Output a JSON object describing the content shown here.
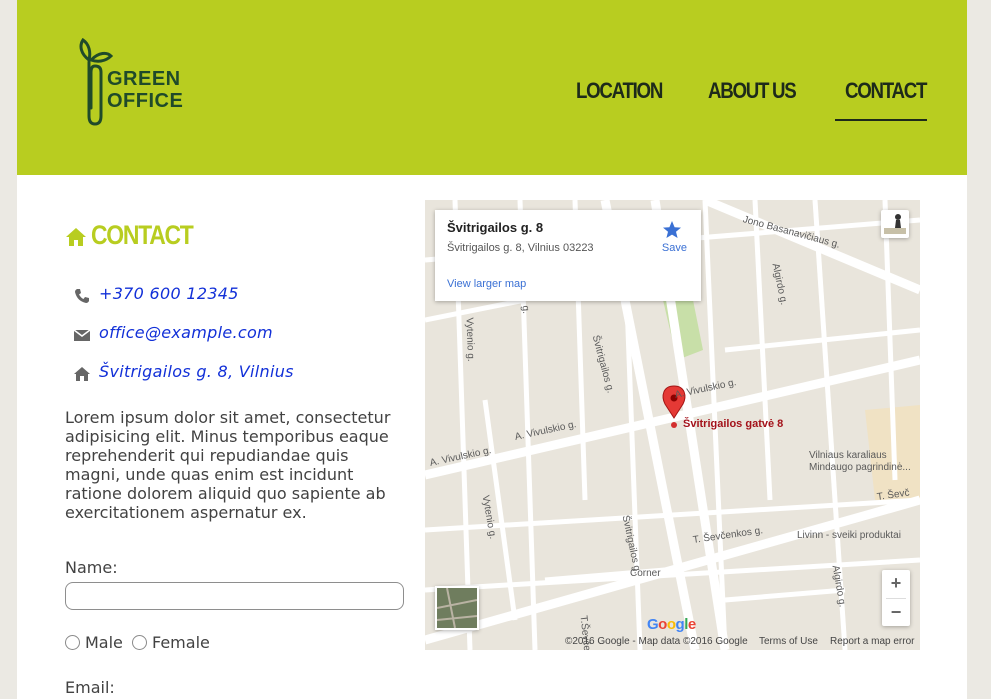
{
  "brand": {
    "line1": "GREEN",
    "line2": "OFFICE"
  },
  "nav": {
    "items": [
      {
        "label": "LOCATION"
      },
      {
        "label": "ABOUT US"
      },
      {
        "label": "CONTACT"
      }
    ],
    "active": "CONTACT"
  },
  "colors": {
    "accent": "#b8cd20",
    "link": "#1230d8",
    "brand_dark": "#1f4a2a"
  },
  "contact": {
    "heading": "CONTACT",
    "phone": "+370 600 12345",
    "email": "office@example.com",
    "address": "Švitrigailos g. 8, Vilnius",
    "description": "Lorem ipsum dolor sit amet, consectetur adipisicing elit. Minus temporibus eaque reprehenderit qui repudiandae quis magni, unde quas enim est incidunt ratione dolorem aliquid quo sapiente ab exercitationem aspernatur ex."
  },
  "form": {
    "name_label": "Name:",
    "name_value": "",
    "gender_options": [
      "Male",
      "Female"
    ],
    "email_label": "Email:"
  },
  "map": {
    "card_title": "Švitrigailos g. 8",
    "card_subtitle": "Švitrigailos g. 8, Vilnius 03223",
    "card_link": "View larger map",
    "save_label": "Save",
    "pin_label": "Švitrigailos gatvė 8",
    "zoom_in": "+",
    "zoom_out": "−",
    "streets": {
      "basanaviciaus": "Jono Basanavičiaus g.",
      "algirdo_top": "Algirdo g.",
      "vytenio_top": "Vytenio g.",
      "s_top": "g.",
      "svitrigailos_top": "Švitrigailos g.",
      "vivulskio_right": "A. Vivulskio g.",
      "vivulskio_mid": "A. Vivulskio g.",
      "vivulskio_left": "A. Vivulskio g.",
      "vytenio_bottom": "Vytenio g.",
      "svitrigailos_bottom": "Švitrigailos g.",
      "sevcenkos_mid": "T. Ševčenkos g.",
      "sevcenkos_right": "T. Ševč",
      "algirdo_bottom": "Algirdo g.",
      "tsev_vertical": "T.Ševčenko",
      "gym_label": "Vilniaus karaliaus Mindaugo pagrindinė...",
      "livinn": "Livinn - sveiki produktai",
      "corner": "Corner"
    },
    "google_logo": "Google",
    "footer": {
      "copyright": "©2016 Google - Map data ©2016 Google",
      "terms": "Terms of Use",
      "report": "Report a map error"
    }
  }
}
